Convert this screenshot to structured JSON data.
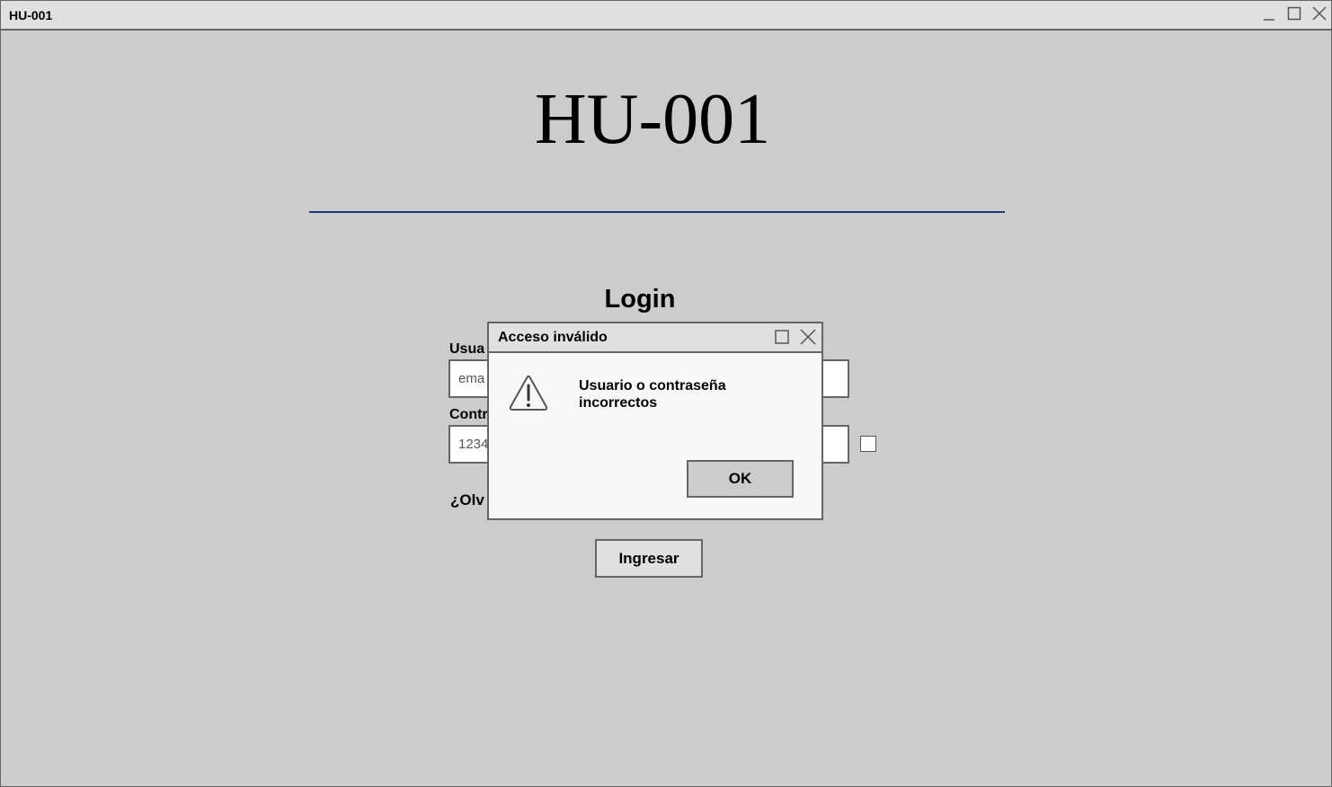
{
  "window": {
    "title": "HU-001"
  },
  "page": {
    "heading": "HU-001",
    "login_title": "Login",
    "username_label": "Usua",
    "username_value": "ema",
    "password_label": "Contr",
    "password_value": "1234",
    "forgot_link": "¿Olv",
    "submit_label": "Ingresar"
  },
  "dialog": {
    "title": "Acceso inválido",
    "message": "Usuario o contraseña incorrectos",
    "ok_label": "OK",
    "icon": "warning-icon"
  },
  "colors": {
    "background": "#cccccc",
    "titlebar": "#e0e0e0",
    "divider": "#1f3a7a",
    "dialog_body": "#f8f8f8"
  }
}
